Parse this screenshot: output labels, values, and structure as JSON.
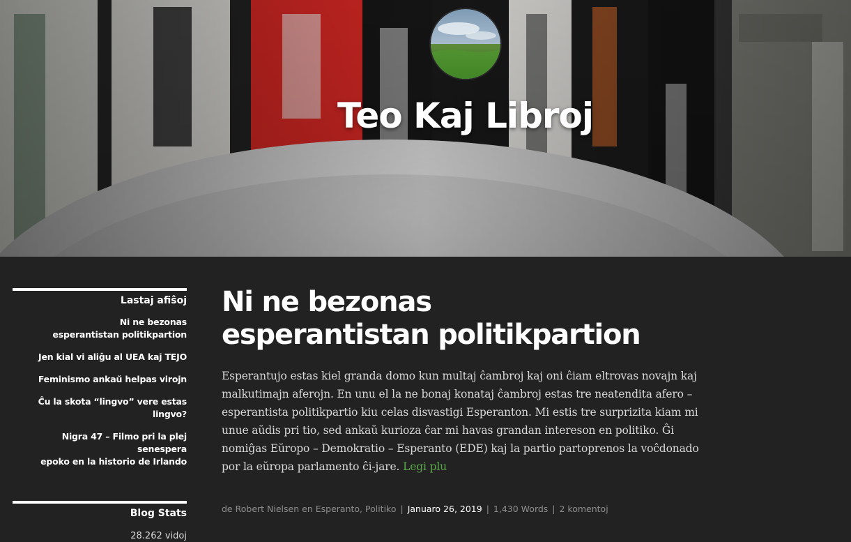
{
  "site": {
    "title": "Teo Kaj Libroj",
    "logo_icon": "grass-field-avatar-icon",
    "header_image": "book-spines-and-cup-photo"
  },
  "sidebar": {
    "recent_posts": {
      "title": "Lastaj afiŝoj",
      "items": [
        {
          "label_lines": [
            "Ni ne bezonas",
            "esperantistan politikpartion"
          ]
        },
        {
          "label_lines": [
            "Jen kial vi aliĝu al UEA kaj TEJO"
          ]
        },
        {
          "label_lines": [
            "Feminismo ankaŭ helpas virojn"
          ]
        },
        {
          "label_lines": [
            "Ĉu la skota “lingvo” vere estas lingvo?"
          ]
        },
        {
          "label_lines": [
            "Nigra 47 – Filmo pri la plej senespera",
            "epoko en la historio de Irlando"
          ]
        }
      ]
    },
    "stats": {
      "title": "Blog Stats",
      "value": "28.262 vidoj"
    }
  },
  "post": {
    "title_lines": [
      "Ni ne bezonas",
      "esperantistan politikpartion"
    ],
    "excerpt": "Esperantujo estas kiel granda domo kun multaj ĉambroj kaj oni ĉiam eltrovas novajn kaj malkutimajn aferojn. En unu el la ne bonaj konataj ĉambroj estas tre neatendita afero – esperantista politikpartio kiu celas disvastigi Esperanton. Mi estis tre surprizita kiam mi unue aŭdis pri tio, sed ankaŭ kurioza ĉar mi havas grandan intereson en politiko. Ĝi nomiĝas Eŭropo – Demokratio – Esperanto (EDE) kaj la partio partoprenos la voĉdonado por la eŭropa parlamento ĉi-jare.",
    "read_more": "Legi plu",
    "meta": {
      "by_prefix": "de",
      "author": "Robert Nielsen",
      "in_prefix": "en",
      "categories": [
        "Esperanto",
        "Politiko"
      ],
      "date": "Januaro 26, 2019",
      "words": "1,430 Words",
      "comments": "2 komentoj",
      "separator": "|"
    }
  },
  "colors": {
    "background": "#222222",
    "link_green": "#5aa84a",
    "text_light": "#d9d9d9",
    "meta_gray": "#8e8e8e"
  }
}
